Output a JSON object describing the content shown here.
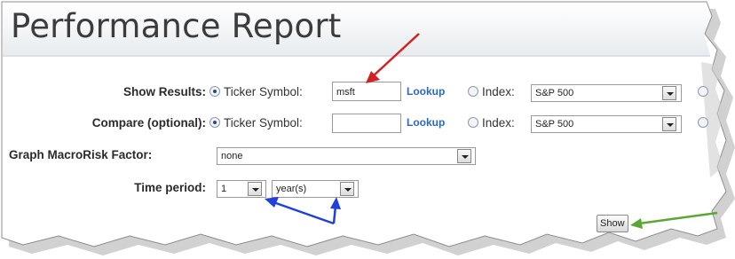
{
  "page": {
    "title": "Performance Report"
  },
  "form": {
    "show_results": {
      "label": "Show Results:",
      "ticker_label": "Ticker Symbol:",
      "ticker_value": "msft",
      "lookup": "Lookup",
      "index_label": "Index:",
      "index_value": "S&P 500"
    },
    "compare": {
      "label": "Compare (optional):",
      "ticker_label": "Ticker Symbol:",
      "ticker_value": "",
      "lookup": "Lookup",
      "index_label": "Index:",
      "index_value": "S&P 500"
    },
    "macro": {
      "label": "Graph MacroRisk Factor:",
      "value": "none"
    },
    "time_period": {
      "label": "Time period:",
      "amount": "1",
      "unit": "year(s)"
    },
    "show_button": "Show"
  },
  "colors": {
    "annotation_red": "#d32020",
    "annotation_blue": "#1f3fe0",
    "annotation_green": "#5aa832",
    "lookup_link": "#2a68c8",
    "header_bg": "#eef1f4"
  },
  "icons": [
    "radio-icon",
    "dropdown-arrow-icon",
    "arrow-annotation-icon"
  ]
}
